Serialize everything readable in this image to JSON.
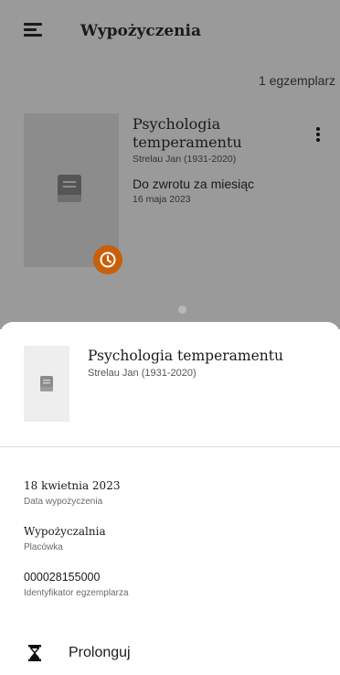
{
  "header": {
    "title": "Wypożyczenia",
    "menu_icon": "menu-icon"
  },
  "summary": {
    "count_text": "1 egzemplarz"
  },
  "loan_card": {
    "title": "Psychologia temperamentu",
    "author": "Strelau Jan (1931-2020)",
    "due_label": "Do zwrotu za miesiąc",
    "due_date": "16 maja 2023",
    "cover_icon": "book-icon",
    "badge_icon": "clock-icon",
    "badge_color": "#c8600a",
    "more_icon": "more-vert-icon"
  },
  "pager": {
    "current_page": 1,
    "total_pages": 1
  },
  "sheet": {
    "title": "Psychologia temperamentu",
    "author": "Strelau Jan (1931-2020)",
    "details": [
      {
        "value": "18 kwietnia 2023",
        "label": "Data wypożyczenia"
      },
      {
        "value": "Wypożyczalnia",
        "label": "Placówka"
      },
      {
        "value": "000028155000",
        "label": "Identyfikator egzemplarza"
      }
    ],
    "action": {
      "label": "Prolonguj",
      "icon": "hourglass-icon"
    }
  },
  "colors": {
    "overlay": "#9a9a9a",
    "accent": "#c8600a",
    "sheet_bg": "#ffffff"
  }
}
